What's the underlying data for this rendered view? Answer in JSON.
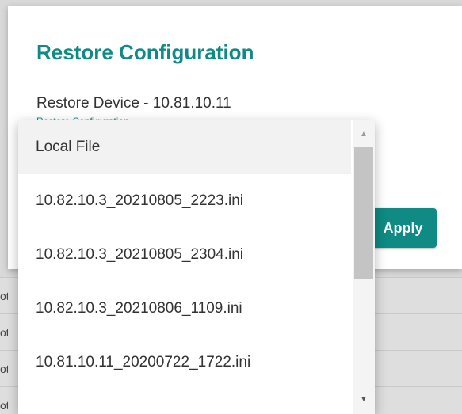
{
  "dialog": {
    "title": "Restore Configuration",
    "field_label": "Restore Device - 10.81.10.11",
    "field_hint": "Restore Configuration",
    "apply_label": "Apply"
  },
  "dropdown": {
    "options": [
      "Local File",
      "10.82.10.3_20210805_2223.ini",
      "10.82.10.3_20210805_2304.ini",
      "10.82.10.3_20210806_1109.ini",
      "10.81.10.11_20200722_1722.ini"
    ],
    "selected_index": 0
  },
  "background": {
    "row_fragments": [
      "ot",
      "ot",
      "ot",
      "ot"
    ]
  },
  "colors": {
    "accent": "#0f8a85",
    "option_selected_bg": "#f2f2f2",
    "scrollbar_thumb": "#c4c4c4"
  },
  "icons": {
    "scroll_up": "triangle-up-icon",
    "scroll_down": "triangle-down-icon"
  }
}
